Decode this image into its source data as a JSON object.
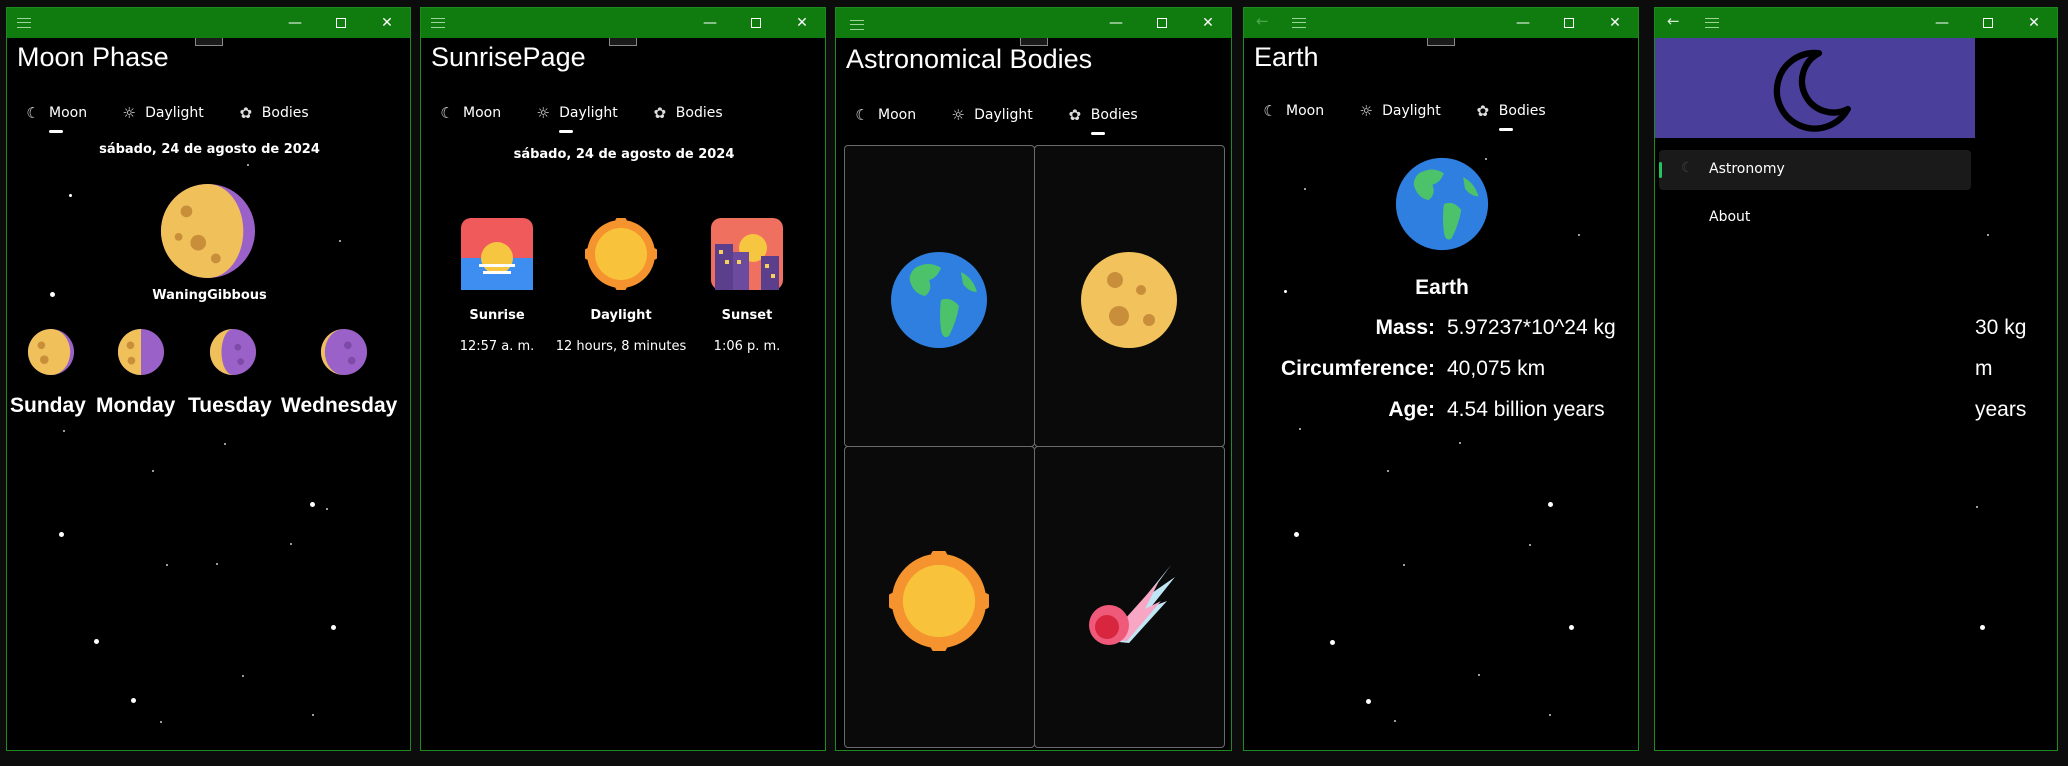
{
  "windows": {
    "moon": {
      "title": "Moon Phase",
      "tabs": [
        {
          "label": "Moon",
          "icon": "moon-icon"
        },
        {
          "label": "Daylight",
          "icon": "sun-outline-icon"
        },
        {
          "label": "Bodies",
          "icon": "comet-icon"
        }
      ],
      "date": "sábado, 24 de agosto de 2024",
      "phase": "WaningGibbous",
      "days": [
        "Sunday",
        "Monday",
        "Tuesday",
        "Wednesday"
      ]
    },
    "sunrise": {
      "title": "SunrisePage",
      "tabs": [
        {
          "label": "Moon"
        },
        {
          "label": "Daylight"
        },
        {
          "label": "Bodies"
        }
      ],
      "date": "sábado, 24 de agosto de 2024",
      "items": [
        {
          "label": "Sunrise",
          "value": "12:57 a. m.",
          "icon": "sunrise-icon"
        },
        {
          "label": "Daylight",
          "value": "12 hours, 8 minutes",
          "icon": "sun-icon"
        },
        {
          "label": "Sunset",
          "value": "1:06 p. m.",
          "icon": "sunset-city-icon"
        }
      ]
    },
    "bodies": {
      "title": "Astronomical Bodies",
      "tabs": [
        {
          "label": "Moon"
        },
        {
          "label": "Daylight"
        },
        {
          "label": "Bodies"
        }
      ],
      "tiles": [
        "earth-icon",
        "full-moon-icon",
        "sun-icon",
        "comet-icon"
      ]
    },
    "earth": {
      "title": "Earth",
      "tabs": [
        {
          "label": "Moon"
        },
        {
          "label": "Daylight"
        },
        {
          "label": "Bodies"
        }
      ],
      "name": "Earth",
      "facts": [
        {
          "key": "Mass:",
          "value": "5.97237*10^24 kg"
        },
        {
          "key": "Circumference:",
          "value": "40,075 km"
        },
        {
          "key": "Age:",
          "value": "4.54 billion years"
        }
      ]
    },
    "nav": {
      "items": [
        {
          "label": "Astronomy"
        },
        {
          "label": "About"
        }
      ],
      "overflow": [
        "30 kg",
        "m",
        "years"
      ],
      "header_color": "#4b3f9c"
    }
  },
  "colors": {
    "accent": "#107c10",
    "border": "#1f8a1f"
  }
}
